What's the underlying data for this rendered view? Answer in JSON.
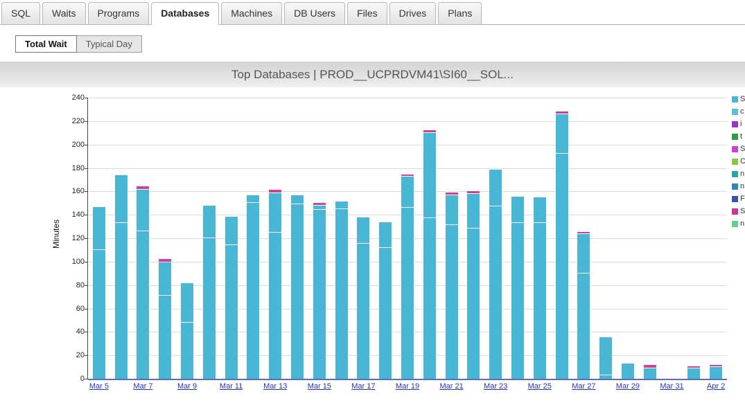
{
  "tabs": {
    "items": [
      {
        "id": "sql",
        "label": "SQL",
        "active": false
      },
      {
        "id": "waits",
        "label": "Waits",
        "active": false
      },
      {
        "id": "programs",
        "label": "Programs",
        "active": false
      },
      {
        "id": "databases",
        "label": "Databases",
        "active": true
      },
      {
        "id": "machines",
        "label": "Machines",
        "active": false
      },
      {
        "id": "db-users",
        "label": "DB Users",
        "active": false
      },
      {
        "id": "files",
        "label": "Files",
        "active": false
      },
      {
        "id": "drives",
        "label": "Drives",
        "active": false
      },
      {
        "id": "plans",
        "label": "Plans",
        "active": false
      }
    ]
  },
  "toolbar": {
    "buttons": [
      {
        "id": "total-wait",
        "label": "Total Wait",
        "active": true
      },
      {
        "id": "typical-day",
        "label": "Typical Day",
        "active": false
      }
    ]
  },
  "chart_data": {
    "type": "stacked-bar",
    "title": "Top Databases  |  PROD__UCPRDVM41\\SI60__SOL...",
    "ylabel": "Minutes",
    "ylim": [
      0,
      240
    ],
    "ytick_step": 20,
    "bar_color": "#4ab6d6",
    "cap_color": "#cc4499",
    "x_labels": [
      "Mar 5",
      "Mar 7",
      "Mar 9",
      "Mar 11",
      "Mar 13",
      "Mar 15",
      "Mar 17",
      "Mar 19",
      "Mar 21",
      "Mar 23",
      "Mar 25",
      "Mar 27",
      "Mar 29",
      "Mar 31",
      "Apr 2"
    ],
    "bars": [
      {
        "date": "Mar 5",
        "v": [
          110,
          36,
          0
        ]
      },
      {
        "date": "Mar 6",
        "v": [
          133,
          40,
          0
        ]
      },
      {
        "date": "Mar 7",
        "v": [
          126,
          35,
          2
        ]
      },
      {
        "date": "Mar 8",
        "v": [
          71,
          28,
          2
        ]
      },
      {
        "date": "Mar 9",
        "v": [
          48,
          33,
          0
        ]
      },
      {
        "date": "Mar 10",
        "v": [
          120,
          27,
          0
        ]
      },
      {
        "date": "Mar 11",
        "v": [
          114,
          24,
          0
        ]
      },
      {
        "date": "Mar 12",
        "v": [
          150,
          6,
          0
        ]
      },
      {
        "date": "Mar 13",
        "v": [
          125,
          33,
          2
        ]
      },
      {
        "date": "Mar 14",
        "v": [
          149,
          7,
          0
        ]
      },
      {
        "date": "Mar 15",
        "v": [
          144,
          3,
          2
        ]
      },
      {
        "date": "Mar 16",
        "v": [
          145,
          6,
          0
        ]
      },
      {
        "date": "Mar 17",
        "v": [
          115,
          22,
          0
        ]
      },
      {
        "date": "Mar 18",
        "v": [
          112,
          21,
          0
        ]
      },
      {
        "date": "Mar 19",
        "v": [
          146,
          26,
          1
        ]
      },
      {
        "date": "Mar 20",
        "v": [
          137,
          72,
          2
        ]
      },
      {
        "date": "Mar 21",
        "v": [
          131,
          25,
          2
        ]
      },
      {
        "date": "Mar 22",
        "v": [
          128,
          29,
          2
        ]
      },
      {
        "date": "Mar 23",
        "v": [
          147,
          31,
          0
        ]
      },
      {
        "date": "Mar 24",
        "v": [
          133,
          22,
          0
        ]
      },
      {
        "date": "Mar 25",
        "v": [
          133,
          21,
          0
        ]
      },
      {
        "date": "Mar 26",
        "v": [
          192,
          33,
          2
        ]
      },
      {
        "date": "Mar 27",
        "v": [
          90,
          33,
          1
        ]
      },
      {
        "date": "Mar 28",
        "v": [
          3,
          32,
          0
        ]
      },
      {
        "date": "Mar 29",
        "v": [
          13,
          0,
          0
        ]
      },
      {
        "date": "Mar 30",
        "v": [
          9,
          0,
          2
        ]
      },
      {
        "date": "Mar 31",
        "v": [
          0,
          0,
          0
        ]
      },
      {
        "date": "Apr 1",
        "v": [
          9,
          0,
          1
        ]
      },
      {
        "date": "Apr 2",
        "v": [
          10,
          0,
          1
        ]
      }
    ],
    "legend": [
      {
        "label": "S",
        "color": "#4ab6d6"
      },
      {
        "label": "c",
        "color": "#56c0dc"
      },
      {
        "label": "i",
        "color": "#9933cc"
      },
      {
        "label": "t",
        "color": "#2e9e38"
      },
      {
        "label": "S",
        "color": "#cc44cc"
      },
      {
        "label": "C",
        "color": "#8cc63f"
      },
      {
        "label": "n",
        "color": "#2fa3a3"
      },
      {
        "label": "n",
        "color": "#2f86b3"
      },
      {
        "label": "F",
        "color": "#3a4fae"
      },
      {
        "label": "S",
        "color": "#cc3399"
      },
      {
        "label": "n",
        "color": "#66cc88"
      }
    ]
  }
}
